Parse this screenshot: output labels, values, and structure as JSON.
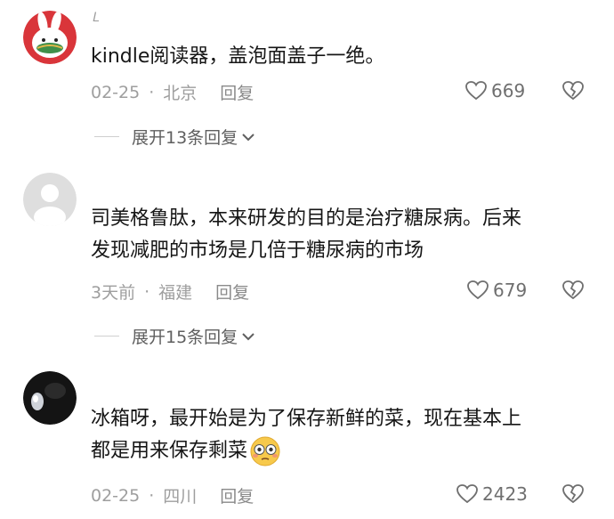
{
  "comments": [
    {
      "username": "𝐿",
      "text_lines": [
        "kindle阅读器，盖泡面盖子一绝。"
      ],
      "date": "02-25",
      "location": "北京",
      "reply_label": "回复",
      "likes": "669",
      "expand_label": "展开13条回复",
      "avatar_icon": "rabbit-avatar-icon"
    },
    {
      "username": "",
      "text_lines": [
        "司美格鲁肽，本来研发的目的是治疗糖尿病。后来",
        "发现减肥的市场是几倍于糖尿病的市场"
      ],
      "date": "3天前",
      "location": "福建",
      "reply_label": "回复",
      "likes": "679",
      "expand_label": "展开15条回复",
      "avatar_icon": "default-user-icon"
    },
    {
      "username": "",
      "text_lines": [
        "冰箱呀，最开始是为了保存新鲜的菜，现在基本上",
        "都是用来保存剩菜"
      ],
      "emoji": "flushed-face-emoji",
      "date": "02-25",
      "location": "四川",
      "reply_label": "回复",
      "likes": "2423",
      "avatar_icon": "dark-photo-avatar"
    }
  ],
  "colors": {
    "text": "#161616",
    "meta": "#9e9e9e",
    "accent_rabbit_bg": "#d9353a"
  }
}
